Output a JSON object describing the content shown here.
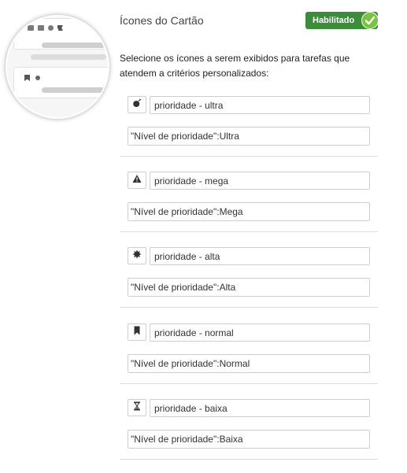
{
  "header": {
    "title": "Ícones do Cartão",
    "toggle_label": "Habilitado",
    "enabled": true
  },
  "description": "Selecione os ícones a serem exibidos para tarefas que atendem a critérios personalizados:",
  "colors": {
    "toggle_bg": "#3d8b3d",
    "toggle_check": "#7bc142"
  },
  "rules": [
    {
      "icon": "bomb-icon",
      "name": "prioridade - ultra",
      "criteria": "\"Nível de prioridade\":Ultra"
    },
    {
      "icon": "warning-icon",
      "name": "prioridade - mega",
      "criteria": "\"Nível de prioridade\":Mega"
    },
    {
      "icon": "burst-icon",
      "name": "prioridade - alta",
      "criteria": "\"Nível de prioridade\":Alta"
    },
    {
      "icon": "bookmark-icon",
      "name": "prioridade - normal",
      "criteria": "\"Nível de prioridade\":Normal"
    },
    {
      "icon": "hourglass-icon",
      "name": "prioridade - baixa",
      "criteria": "\"Nível de prioridade\":Baixa"
    }
  ]
}
